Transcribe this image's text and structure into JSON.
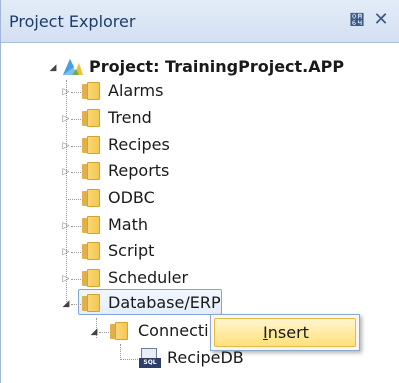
{
  "panel": {
    "title": "Project Explorer",
    "pin_glyph": "੤",
    "close_glyph": "✕"
  },
  "tree": {
    "root": {
      "label": "Project: TrainingProject.APP",
      "icon": "project-icon",
      "expanded": true
    },
    "items": [
      {
        "label": "Alarms",
        "icon": "folder-icon",
        "expandable": true
      },
      {
        "label": "Trend",
        "icon": "folder-icon",
        "expandable": true
      },
      {
        "label": "Recipes",
        "icon": "folder-icon",
        "expandable": true
      },
      {
        "label": "Reports",
        "icon": "folder-icon",
        "expandable": true
      },
      {
        "label": "ODBC",
        "icon": "folder-icon",
        "expandable": false
      },
      {
        "label": "Math",
        "icon": "folder-icon",
        "expandable": true
      },
      {
        "label": "Script",
        "icon": "folder-icon",
        "expandable": true
      },
      {
        "label": "Scheduler",
        "icon": "folder-icon",
        "expandable": true
      },
      {
        "label": "Database/ERP",
        "icon": "folder-icon",
        "expandable": true,
        "expanded": true,
        "selected": true
      }
    ],
    "database_children": [
      {
        "label": "Connecti",
        "icon": "folder-icon",
        "expanded": true
      }
    ],
    "connection_children": [
      {
        "label": "RecipeDB",
        "icon": "sql-database-icon",
        "icon_tag": "SQL"
      }
    ]
  },
  "context_menu": {
    "items": [
      {
        "label": "Insert",
        "highlighted": true
      }
    ]
  },
  "colors": {
    "titlebar": "#d9e5f5",
    "selection_border": "#7ea7d8",
    "menu_highlight": "#ffe07a",
    "folder": "#f5c650"
  }
}
